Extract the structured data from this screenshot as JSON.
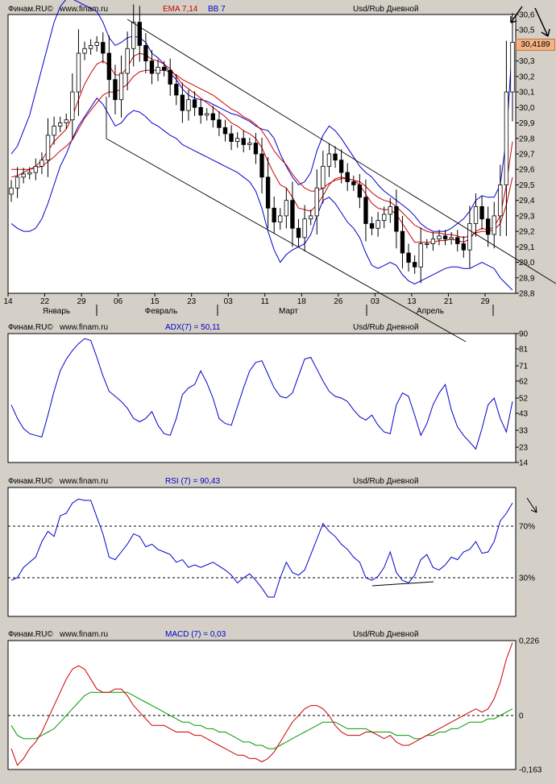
{
  "header": {
    "source": "Финам.RU©",
    "site": "www.finam.ru",
    "instrument": "Usd/Rub Дневной"
  },
  "panels": {
    "price": {
      "ema_label": "EMA 7,14",
      "bb_label": "BB 7",
      "last_price": "30,4189"
    },
    "adx": {
      "label": "ADX(7) = 50,11"
    },
    "rsi": {
      "label": "RSI (7) = 90,43"
    },
    "macd": {
      "label": "MACD (7) = 0,03"
    }
  },
  "colors": {
    "background": "#d4d0c8",
    "plot_bg": "#ffffff",
    "candles": "#000000",
    "bollinger": "#0000cc",
    "ema": "#cc0000",
    "adx": "#0000cc",
    "rsi": "#0000cc",
    "macd": "#cc0000",
    "signal": "#009900",
    "price_tag": "#f4b183"
  },
  "chart_data": [
    {
      "type": "candlestick",
      "title": "Usd/Rub Дневной",
      "x_tick_labels": [
        "14",
        "22",
        "29",
        "06",
        "15",
        "23",
        "03",
        "11",
        "18",
        "26",
        "03",
        "13",
        "21",
        "29"
      ],
      "month_labels": [
        "Январь",
        "Февраль",
        "Март",
        "Апрель"
      ],
      "y_tick_labels": [
        "28,8",
        "28,9",
        "29,0",
        "29,1",
        "29,2",
        "29,3",
        "29,4",
        "29,5",
        "29,6",
        "29,7",
        "29,8",
        "29,9",
        "30,0",
        "30,1",
        "30,2",
        "30,3",
        "30,4",
        "30,5",
        "30,6"
      ],
      "ylim": [
        28.8,
        30.6
      ],
      "close": [
        29.48,
        29.55,
        29.57,
        29.58,
        29.62,
        29.66,
        29.82,
        29.88,
        29.9,
        29.92,
        30.1,
        30.35,
        30.38,
        30.4,
        30.42,
        30.35,
        30.18,
        30.05,
        30.22,
        30.38,
        30.55,
        30.4,
        30.3,
        30.22,
        30.26,
        30.24,
        30.15,
        30.08,
        29.98,
        30.05,
        30.0,
        29.95,
        29.96,
        29.92,
        29.87,
        29.83,
        29.78,
        29.8,
        29.76,
        29.77,
        29.7,
        29.55,
        29.35,
        29.26,
        29.3,
        29.4,
        29.22,
        29.16,
        29.28,
        29.3,
        29.48,
        29.62,
        29.7,
        29.66,
        29.58,
        29.52,
        29.5,
        29.42,
        29.25,
        29.22,
        29.27,
        29.31,
        29.36,
        29.2,
        29.06,
        29.0,
        28.97,
        29.12,
        29.12,
        29.15,
        29.17,
        29.15,
        29.16,
        29.12,
        29.08,
        29.25,
        29.36,
        29.28,
        29.18,
        29.3,
        29.5,
        30.1,
        30.42
      ],
      "bollinger_upper": [
        29.7,
        29.75,
        29.85,
        29.95,
        30.1,
        30.25,
        30.4,
        30.55,
        30.65,
        30.7,
        30.7,
        30.68,
        30.66,
        30.64,
        30.62,
        30.55,
        30.45,
        30.4,
        30.42,
        30.45,
        30.46,
        30.45,
        30.42,
        30.35,
        30.32,
        30.28,
        30.22,
        30.18,
        30.12,
        30.08,
        30.06,
        30.05,
        30.04,
        30.02,
        30.0,
        29.98,
        29.96,
        29.95,
        29.93,
        29.91,
        29.88,
        29.86,
        29.85,
        29.8,
        29.7,
        29.62,
        29.55,
        29.5,
        29.52,
        29.58,
        29.72,
        29.82,
        29.88,
        29.85,
        29.8,
        29.74,
        29.68,
        29.62,
        29.58,
        29.55,
        29.5,
        29.46,
        29.43,
        29.4,
        29.37,
        29.34,
        29.3,
        29.25,
        29.22,
        29.2,
        29.2,
        29.2,
        29.22,
        29.25,
        29.28,
        29.33,
        29.4,
        29.43,
        29.42,
        29.42,
        29.5,
        29.8,
        30.42
      ],
      "bollinger_lower": [
        29.25,
        29.22,
        29.2,
        29.2,
        29.22,
        29.28,
        29.38,
        29.5,
        29.62,
        29.7,
        29.8,
        29.88,
        29.94,
        30.0,
        30.06,
        30.02,
        29.95,
        29.88,
        29.9,
        29.95,
        29.98,
        29.97,
        29.94,
        29.9,
        29.88,
        29.85,
        29.82,
        29.8,
        29.76,
        29.74,
        29.72,
        29.7,
        29.68,
        29.66,
        29.64,
        29.62,
        29.6,
        29.58,
        29.55,
        29.52,
        29.46,
        29.35,
        29.2,
        29.08,
        29.0,
        29.05,
        29.08,
        29.1,
        29.12,
        29.18,
        29.3,
        29.4,
        29.42,
        29.38,
        29.32,
        29.26,
        29.22,
        29.16,
        29.06,
        28.98,
        28.96,
        28.98,
        29.0,
        28.98,
        28.92,
        28.88,
        28.86,
        28.88,
        28.9,
        28.92,
        28.94,
        28.96,
        28.97,
        28.97,
        28.96,
        28.96,
        28.98,
        29.0,
        28.98,
        28.96,
        28.9,
        28.86,
        28.82
      ],
      "ema_7": [
        29.55,
        29.56,
        29.58,
        29.6,
        29.62,
        29.66,
        29.72,
        29.78,
        29.82,
        29.86,
        29.94,
        30.05,
        30.15,
        30.22,
        30.28,
        30.3,
        30.27,
        30.21,
        30.21,
        30.26,
        30.33,
        30.35,
        30.34,
        30.31,
        30.3,
        30.28,
        30.25,
        30.2,
        30.15,
        30.12,
        30.09,
        30.06,
        30.03,
        30.0,
        29.97,
        29.94,
        29.9,
        29.88,
        29.85,
        29.83,
        29.8,
        29.74,
        29.65,
        29.57,
        29.5,
        29.48,
        29.42,
        29.35,
        29.34,
        29.33,
        29.37,
        29.43,
        29.5,
        29.54,
        29.55,
        29.54,
        29.53,
        29.5,
        29.44,
        29.38,
        29.35,
        29.34,
        29.34,
        29.31,
        29.25,
        29.19,
        29.13,
        29.13,
        29.13,
        29.13,
        29.14,
        29.14,
        29.15,
        29.14,
        29.13,
        29.15,
        29.2,
        29.22,
        29.21,
        29.23,
        29.3,
        29.5,
        29.78
      ],
      "ema_14": [
        29.6,
        29.6,
        29.6,
        29.6,
        29.61,
        29.62,
        29.65,
        29.68,
        29.72,
        29.75,
        29.79,
        29.86,
        29.93,
        29.98,
        30.03,
        30.08,
        30.1,
        30.1,
        30.12,
        30.15,
        30.2,
        30.23,
        30.24,
        30.24,
        30.24,
        30.24,
        30.23,
        30.21,
        30.18,
        30.16,
        30.14,
        30.12,
        30.1,
        30.08,
        30.05,
        30.02,
        29.99,
        29.97,
        29.94,
        29.92,
        29.89,
        29.85,
        29.79,
        29.72,
        29.67,
        29.63,
        29.57,
        29.52,
        29.48,
        29.46,
        29.46,
        29.48,
        29.51,
        29.53,
        29.54,
        29.54,
        29.53,
        29.52,
        29.49,
        29.45,
        29.42,
        29.4,
        29.39,
        29.36,
        29.32,
        29.28,
        29.24,
        29.22,
        29.2,
        29.19,
        29.19,
        29.18,
        29.18,
        29.17,
        29.16,
        29.17,
        29.19,
        29.2,
        29.2,
        29.21,
        29.25,
        29.37,
        29.55
      ]
    },
    {
      "type": "line",
      "title": "ADX(7) = 50,11",
      "y_tick_labels": [
        "14",
        "23",
        "33",
        "43",
        "52",
        "62",
        "71",
        "81",
        "90"
      ],
      "ylim": [
        14,
        90
      ],
      "series": [
        {
          "name": "ADX(7)",
          "values": [
            48,
            40,
            34,
            31,
            30,
            29,
            42,
            56,
            68,
            75,
            80,
            84,
            87,
            86,
            76,
            65,
            56,
            53,
            50,
            46,
            40,
            38,
            40,
            44,
            36,
            31,
            30,
            40,
            54,
            58,
            60,
            68,
            61,
            52,
            40,
            37,
            36,
            47,
            58,
            68,
            73,
            74,
            66,
            58,
            53,
            52,
            55,
            65,
            75,
            76,
            69,
            62,
            56,
            53,
            52,
            50,
            45,
            41,
            39,
            42,
            36,
            32,
            31,
            48,
            55,
            53,
            42,
            30,
            37,
            48,
            55,
            60,
            45,
            35,
            30,
            26,
            22,
            34,
            48,
            52,
            40,
            32,
            50
          ]
        }
      ]
    },
    {
      "type": "line",
      "title": "RSI (7) = 90,43",
      "y_tick_labels": [
        "30%",
        "70%"
      ],
      "ylim": [
        0,
        100
      ],
      "series": [
        {
          "name": "RSI (7)",
          "values": [
            28,
            30,
            38,
            42,
            46,
            58,
            66,
            62,
            78,
            80,
            88,
            91,
            90,
            90,
            77,
            64,
            46,
            44,
            50,
            56,
            64,
            62,
            54,
            56,
            52,
            50,
            48,
            42,
            44,
            38,
            40,
            38,
            40,
            42,
            39,
            36,
            32,
            26,
            30,
            33,
            28,
            22,
            15,
            15,
            30,
            42,
            34,
            32,
            36,
            48,
            60,
            72,
            66,
            62,
            56,
            52,
            46,
            42,
            30,
            28,
            31,
            38,
            50,
            34,
            28,
            26,
            32,
            44,
            48,
            38,
            36,
            40,
            46,
            44,
            50,
            52,
            58,
            49,
            50,
            58,
            74,
            80,
            88
          ]
        }
      ]
    },
    {
      "type": "line",
      "title": "MACD (7) = 0,03",
      "y_tick_labels": [
        "-0,163",
        "0",
        "0,226"
      ],
      "ylim": [
        -0.163,
        0.226
      ],
      "series": [
        {
          "name": "MACD (7)",
          "values": [
            -0.1,
            -0.15,
            -0.13,
            -0.1,
            -0.08,
            -0.05,
            -0.01,
            0.03,
            0.07,
            0.11,
            0.14,
            0.15,
            0.14,
            0.11,
            0.08,
            0.07,
            0.07,
            0.08,
            0.08,
            0.06,
            0.03,
            0.01,
            -0.01,
            -0.03,
            -0.03,
            -0.03,
            -0.04,
            -0.05,
            -0.05,
            -0.05,
            -0.06,
            -0.06,
            -0.07,
            -0.08,
            -0.09,
            -0.1,
            -0.11,
            -0.12,
            -0.12,
            -0.13,
            -0.13,
            -0.14,
            -0.13,
            -0.11,
            -0.08,
            -0.05,
            -0.02,
            0.0,
            0.02,
            0.03,
            0.03,
            0.02,
            0.0,
            -0.03,
            -0.05,
            -0.06,
            -0.06,
            -0.06,
            -0.05,
            -0.05,
            -0.06,
            -0.07,
            -0.06,
            -0.08,
            -0.09,
            -0.09,
            -0.08,
            -0.07,
            -0.06,
            -0.05,
            -0.04,
            -0.03,
            -0.02,
            -0.01,
            0.0,
            0.01,
            0.02,
            0.01,
            0.02,
            0.05,
            0.1,
            0.17,
            0.22
          ]
        },
        {
          "name": "Signal",
          "values": [
            -0.03,
            -0.06,
            -0.07,
            -0.07,
            -0.07,
            -0.06,
            -0.05,
            -0.04,
            -0.02,
            0.0,
            0.02,
            0.04,
            0.06,
            0.07,
            0.07,
            0.07,
            0.07,
            0.07,
            0.07,
            0.07,
            0.06,
            0.05,
            0.04,
            0.03,
            0.02,
            0.01,
            0.0,
            -0.01,
            -0.02,
            -0.02,
            -0.03,
            -0.03,
            -0.04,
            -0.04,
            -0.05,
            -0.05,
            -0.06,
            -0.07,
            -0.08,
            -0.08,
            -0.09,
            -0.09,
            -0.1,
            -0.1,
            -0.09,
            -0.08,
            -0.07,
            -0.06,
            -0.05,
            -0.04,
            -0.03,
            -0.02,
            -0.02,
            -0.02,
            -0.03,
            -0.04,
            -0.04,
            -0.04,
            -0.04,
            -0.05,
            -0.05,
            -0.05,
            -0.05,
            -0.06,
            -0.06,
            -0.06,
            -0.07,
            -0.07,
            -0.06,
            -0.06,
            -0.05,
            -0.05,
            -0.04,
            -0.04,
            -0.03,
            -0.02,
            -0.02,
            -0.02,
            -0.01,
            -0.01,
            0.0,
            0.01,
            0.02
          ]
        }
      ]
    }
  ]
}
